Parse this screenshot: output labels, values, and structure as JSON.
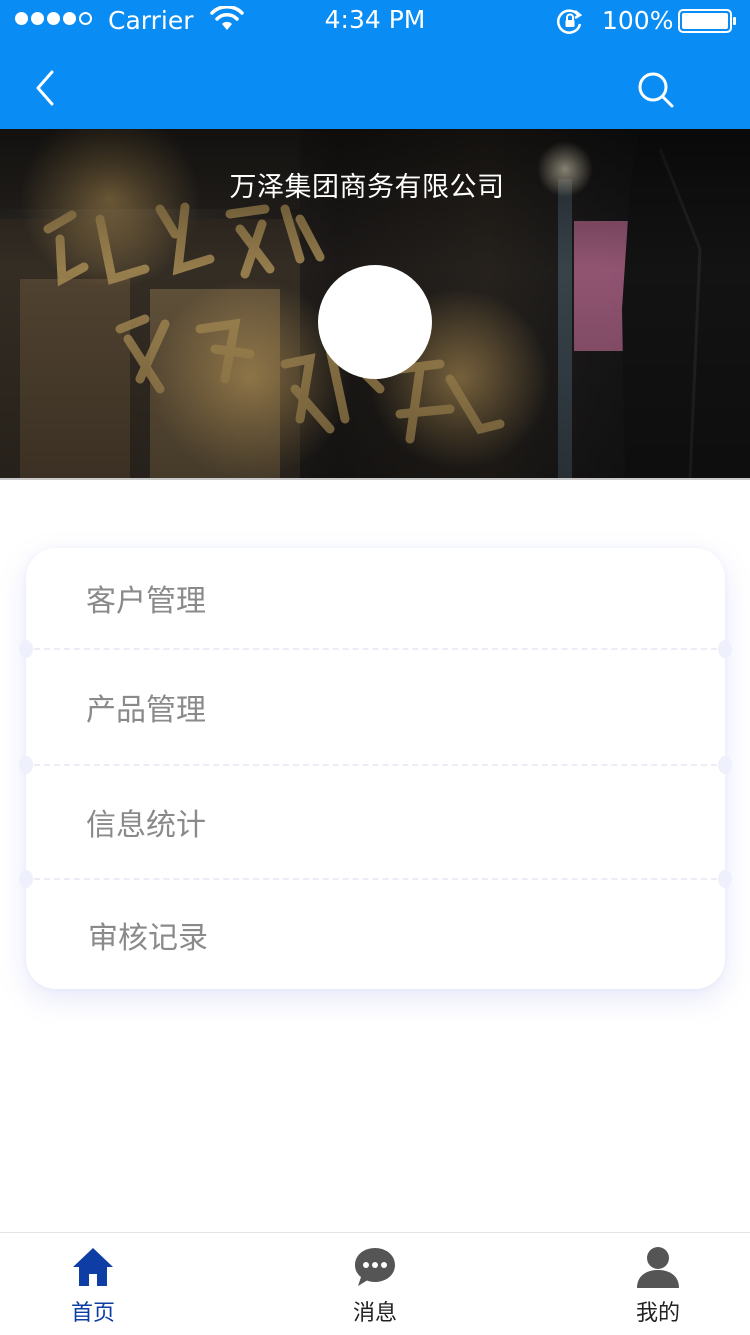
{
  "status_bar": {
    "carrier": "Carrier",
    "time": "4:34 PM",
    "battery": "100%"
  },
  "nav": {
    "back_icon": "back-chevron-icon",
    "search_icon": "search-icon"
  },
  "banner": {
    "company_name": "万泽集团商务有限公司"
  },
  "menu": {
    "items": [
      {
        "label": "客户管理"
      },
      {
        "label": "产品管理"
      },
      {
        "label": "信息统计"
      },
      {
        "label": "审核记录"
      }
    ]
  },
  "tab_bar": {
    "tabs": [
      {
        "label": "首页",
        "icon": "home-icon",
        "active": true
      },
      {
        "label": "消息",
        "icon": "chat-bubble-icon",
        "active": false
      },
      {
        "label": "我的",
        "icon": "user-icon",
        "active": false
      }
    ]
  },
  "colors": {
    "header_blue": "#0a8cf5",
    "tab_active": "#0e3ea5",
    "menu_text": "#8a8a8a"
  }
}
